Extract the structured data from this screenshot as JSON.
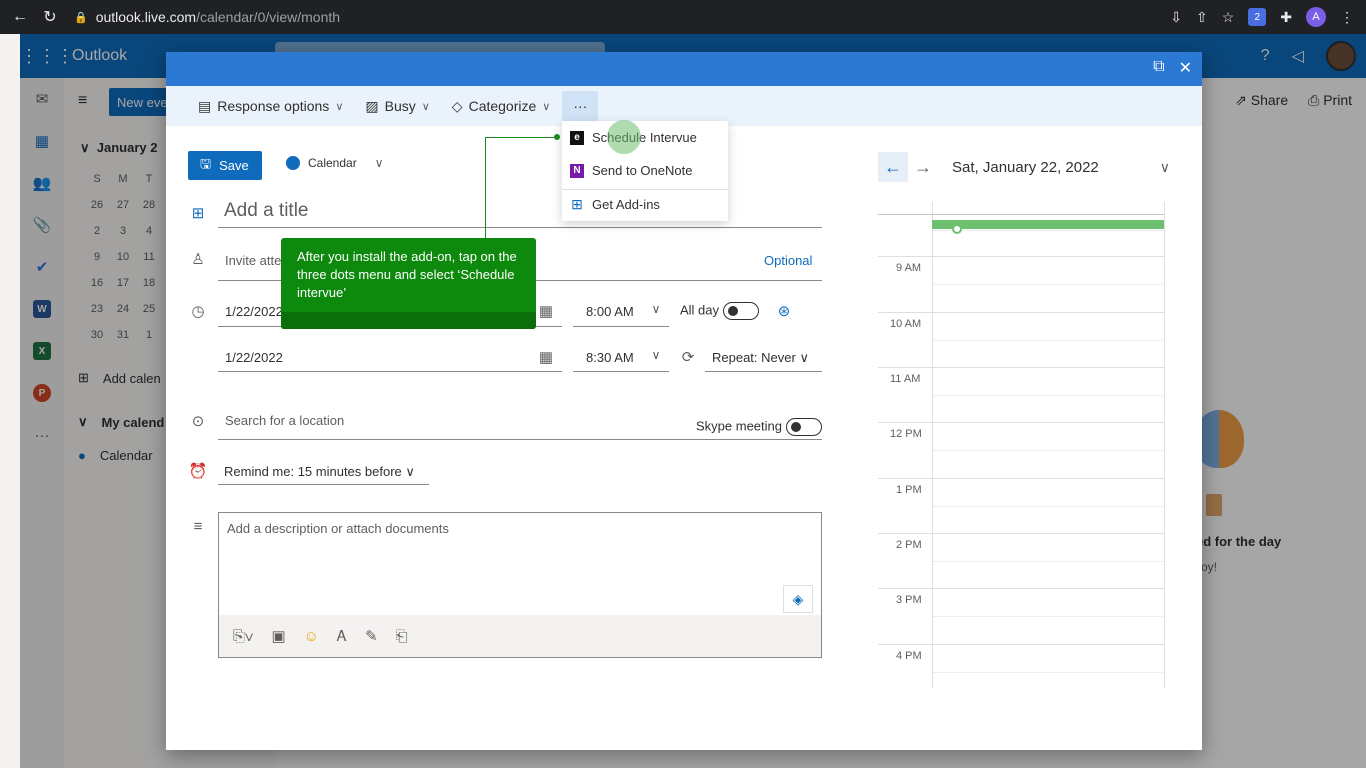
{
  "browser": {
    "url_host": "outlook.live.com",
    "url_path": "/calendar/0/view/month",
    "ext_badge_count": "2",
    "profile_initial": "A"
  },
  "outlook": {
    "brand": "Outlook",
    "new_event_label": "New eve",
    "month_header": "January 2",
    "mini_calendar": {
      "weekday_headers": [
        "S",
        "M",
        "T"
      ],
      "weeks": [
        [
          "26",
          "27",
          "28"
        ],
        [
          "2",
          "3",
          "4"
        ],
        [
          "9",
          "10",
          "11"
        ],
        [
          "16",
          "17",
          "18"
        ],
        [
          "23",
          "24",
          "25"
        ],
        [
          "30",
          "31",
          "1"
        ]
      ]
    },
    "add_calendar_label": "Add calen",
    "my_calendars_label": "My calend",
    "calendar_item_label": "Calendar",
    "share_label": "Share",
    "print_label": "Print",
    "nothing_planned": "ed for the day",
    "enjoy_text": "oy!"
  },
  "dialog": {
    "toolbar": {
      "response_options": "Response options",
      "busy": "Busy",
      "categorize": "Categorize",
      "more": "···"
    },
    "save_label": "Save",
    "calendar_label": "Calendar",
    "title_placeholder": "Add a title",
    "invite_placeholder": "Invite atte",
    "optional_label": "Optional",
    "start_date": "1/22/2022",
    "start_time": "8:00 AM",
    "all_day_label": "All day",
    "end_date": "1/22/2022",
    "end_time": "8:30 AM",
    "repeat_label": "Repeat: Never",
    "location_placeholder": "Search for a location",
    "skype_label": "Skype meeting",
    "remind_label": "Remind me: 15 minutes before",
    "description_placeholder": "Add a description or attach documents"
  },
  "menu": {
    "items": [
      {
        "label": "Schedule Intervue",
        "icon": "intervue-icon"
      },
      {
        "label": "Send to OneNote",
        "icon": "onenote-icon"
      },
      {
        "label": "Get Add-ins",
        "icon": "add-ins-icon"
      }
    ]
  },
  "day_view": {
    "date_title": "Sat, January 22, 2022",
    "hours": [
      "9 AM",
      "10 AM",
      "11 AM",
      "12 PM",
      "1 PM",
      "2 PM",
      "3 PM",
      "4 PM"
    ]
  },
  "tooltip": {
    "text": "After you install the add-on, tap on the three dots menu and select ‘Schedule intervue’"
  },
  "colors": {
    "outlook_blue": "#0f6cbd",
    "dialog_title_blue": "#2b79d3",
    "tooltip_green": "#0d8a0d",
    "event_green": "#6cc070"
  }
}
